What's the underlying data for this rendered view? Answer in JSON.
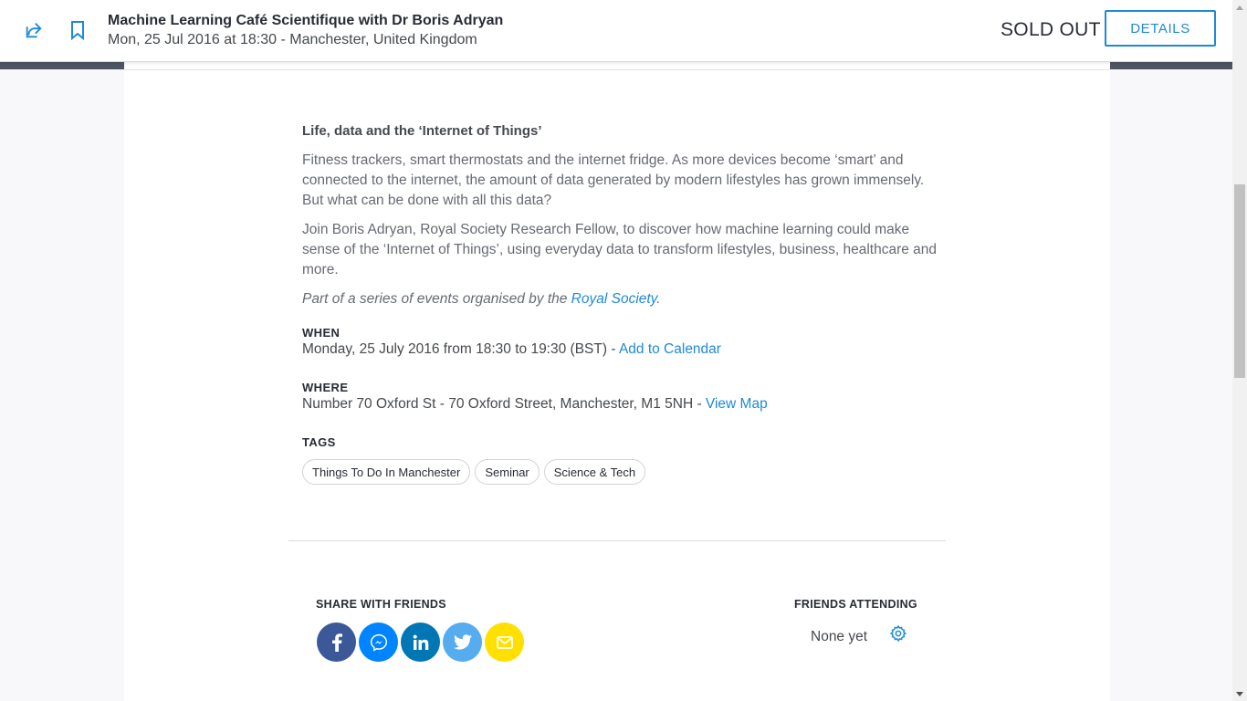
{
  "header": {
    "event_title": "Machine Learning Café Scientifique with Dr Boris Adryan",
    "event_subtitle": "Mon, 25 Jul 2016 at 18:30 - Manchester, United Kingdom",
    "status": "SOLD OUT",
    "details_button": "DETAILS",
    "icons": [
      "share-icon",
      "bookmark-icon"
    ]
  },
  "description": {
    "heading": "Life, data and the ‘Internet of Things’",
    "paragraph1": "Fitness trackers, smart thermostats and the internet fridge. As more devices become ‘smart’ and connected to the internet, the amount of data generated by modern lifestyles has grown immensely. But what can be done with all this data?",
    "paragraph2": "Join Boris Adryan, Royal Society Research Fellow, to discover how machine learning could make sense of the ‘Internet of Things’, using everyday data to transform lifestyles, business, healthcare and more.",
    "series_prefix": "Part of a series of events organised by the ",
    "series_link": "Royal Society",
    "series_suffix": "."
  },
  "when": {
    "label": "WHEN",
    "text": "Monday, 25 July 2016 from 18:30 to 19:30 (BST) - ",
    "link": "Add to Calendar"
  },
  "where": {
    "label": "WHERE",
    "text": "Number 70 Oxford St - 70 Oxford Street, Manchester, M1 5NH - ",
    "link": "View Map"
  },
  "tags": {
    "label": "TAGS",
    "items": [
      "Things To Do In Manchester",
      "Seminar",
      "Science & Tech"
    ]
  },
  "share": {
    "label": "SHARE WITH FRIENDS",
    "buttons": [
      {
        "icon": "facebook-icon",
        "color": "#3b5998"
      },
      {
        "icon": "messenger-icon",
        "color": "#0084ff"
      },
      {
        "icon": "linkedin-icon",
        "color": "#0077b5"
      },
      {
        "icon": "twitter-icon",
        "color": "#55acee"
      },
      {
        "icon": "email-icon",
        "color": "#ffe000"
      }
    ]
  },
  "friends": {
    "label": "FRIENDS ATTENDING",
    "value": "None yet",
    "icon": "gear-icon"
  },
  "colors": {
    "accent": "#1e8ad6",
    "header_strip": "#4e5462"
  }
}
